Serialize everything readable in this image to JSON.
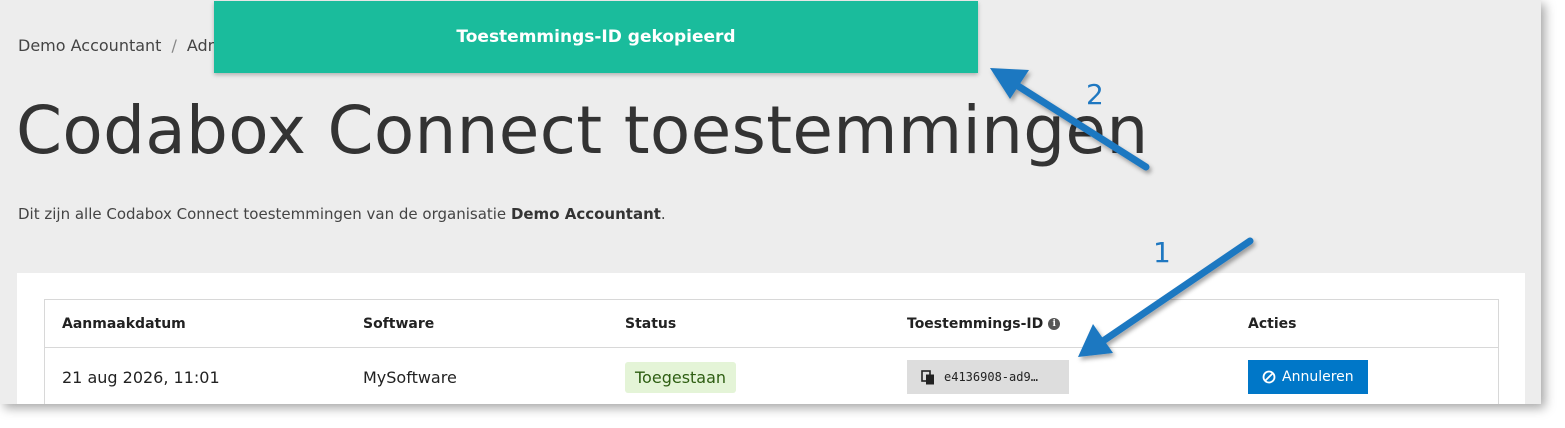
{
  "breadcrumb": {
    "home": "Demo Accountant",
    "separator": "/",
    "current": "Adm"
  },
  "page": {
    "title": "Codabox Connect toestemmingen",
    "intro_prefix": "Dit zijn alle Codabox Connect toestemmingen van de organisatie ",
    "intro_org": "Demo Accountant",
    "intro_suffix": "."
  },
  "table": {
    "columns": [
      "Aanmaakdatum",
      "Software",
      "Status",
      "Toestemmings-ID",
      "Acties"
    ],
    "rows": [
      {
        "created": "21 aug 2026, 11:01",
        "software": "MySoftware",
        "status": "Toegestaan",
        "consent_id": "e4136908-ad9…",
        "action": "Annuleren"
      }
    ]
  },
  "toast": {
    "message": "Toestemmings-ID gekopieerd"
  },
  "annotations": {
    "callout_1": "1",
    "callout_2": "2"
  },
  "icons": {
    "info": "info-icon",
    "copy": "copy-icon",
    "cancel": "cancel-icon"
  },
  "colors": {
    "toast_bg": "#1abc9c",
    "primary_button": "#0077c8",
    "status_badge_bg": "#e4f4d7",
    "status_badge_text": "#2e5e12",
    "annotation_blue": "#1f78c1"
  }
}
